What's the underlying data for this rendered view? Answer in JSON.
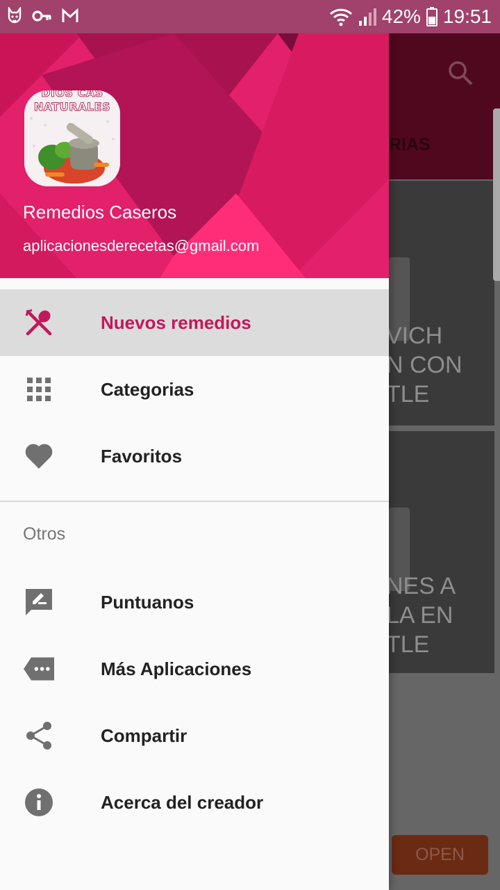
{
  "status_bar": {
    "battery_percent": "42%",
    "time": "19:51",
    "left_icons": [
      "cat-notification-icon",
      "key-icon",
      "gmail-icon"
    ],
    "right_icons": [
      "wifi-icon",
      "signal-icon",
      "battery-icon"
    ]
  },
  "background": {
    "tab_fragment": "RIAS",
    "card1_text": "VICH\nN CON\nTLE",
    "card2_text": "NES A\nLA EN\nTLE",
    "open_button": "OPEN"
  },
  "drawer": {
    "logo_line1": "DIOS CAS",
    "logo_line2": "NATURALES",
    "name": "Remedios Caseros",
    "email": "aplicacionesderecetas@gmail.com",
    "items": [
      {
        "label": "Nuevos remedios",
        "icon": "fork-spoon-icon",
        "active": true
      },
      {
        "label": "Categorias",
        "icon": "grid-icon"
      },
      {
        "label": "Favoritos",
        "icon": "heart-icon"
      }
    ],
    "section_title": "Otros",
    "other_items": [
      {
        "label": "Puntuanos",
        "icon": "rate-review-icon"
      },
      {
        "label": "Más Aplicaciones",
        "icon": "more-apps-icon"
      },
      {
        "label": "Compartir",
        "icon": "share-icon"
      },
      {
        "label": "Acerca del creador",
        "icon": "info-icon"
      }
    ]
  },
  "colors": {
    "accent": "#c2185b",
    "header_pink": "#e91e63",
    "status_bar": "#a0426b"
  }
}
